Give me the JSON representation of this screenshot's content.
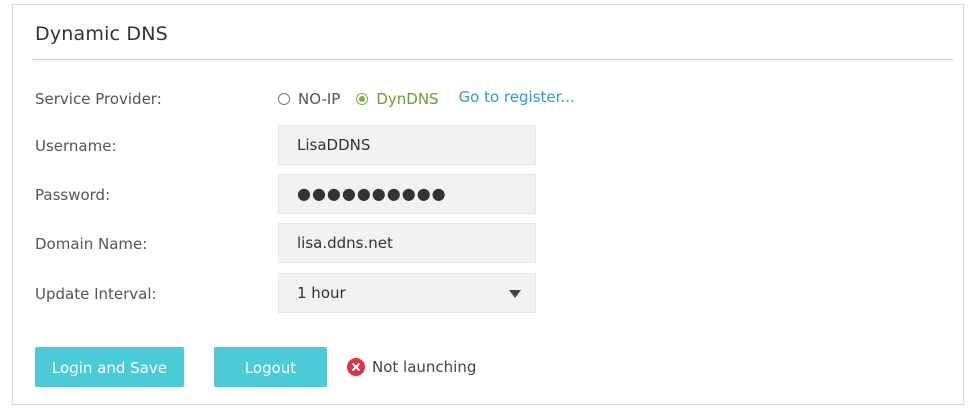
{
  "panel": {
    "title": "Dynamic DNS"
  },
  "service_provider": {
    "label": "Service Provider:",
    "options": [
      {
        "label": "NO-IP",
        "selected": false
      },
      {
        "label": "DynDNS",
        "selected": true
      }
    ],
    "register_link": "Go to register..."
  },
  "username": {
    "label": "Username:",
    "value": "LisaDDNS"
  },
  "password": {
    "label": "Password:",
    "value": "●●●●●●●●●●"
  },
  "domain_name": {
    "label": "Domain Name:",
    "value": "lisa.ddns.net"
  },
  "update_interval": {
    "label": "Update Interval:",
    "selected": "1 hour"
  },
  "buttons": {
    "login_save": "Login and Save",
    "logout": "Logout"
  },
  "status": {
    "text": "Not launching",
    "icon": "close-circle-icon",
    "color": "#e0334a"
  },
  "colors": {
    "accent": "#4acbd6",
    "selected_green": "#6aa32e",
    "link_blue": "#2a9fc9"
  }
}
